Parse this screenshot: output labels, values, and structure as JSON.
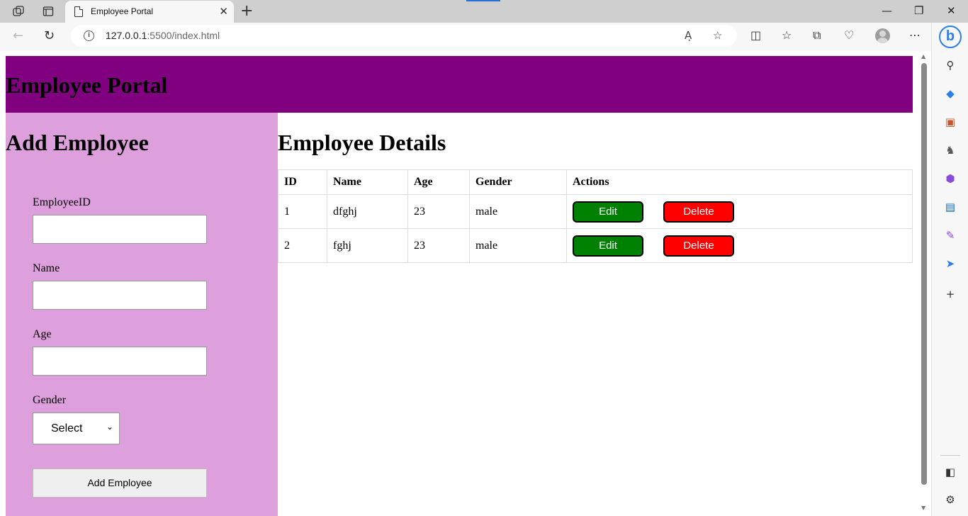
{
  "browser": {
    "tab_title": "Employee Portal",
    "url_host": "127.0.0.1",
    "url_path": ":5500/index.html",
    "read_aloud_label": "Aͅ",
    "bing_label": "b"
  },
  "page": {
    "header_title": "Employee Portal",
    "form": {
      "heading": "Add Employee",
      "employee_id_label": "EmployeeID",
      "name_label": "Name",
      "age_label": "Age",
      "gender_label": "Gender",
      "gender_selected": "Select",
      "submit_label": "Add Employee"
    },
    "details": {
      "heading": "Employee Details",
      "columns": [
        "ID",
        "Name",
        "Age",
        "Gender",
        "Actions"
      ],
      "rows": [
        {
          "id": "1",
          "name": "dfghj",
          "age": "23",
          "gender": "male"
        },
        {
          "id": "2",
          "name": "fghj",
          "age": "23",
          "gender": "male"
        }
      ],
      "edit_label": "Edit",
      "delete_label": "Delete"
    }
  },
  "colors": {
    "header_bg": "#800080",
    "form_bg": "#dda0dd",
    "edit_bg": "#008000",
    "delete_bg": "#ff0000"
  }
}
